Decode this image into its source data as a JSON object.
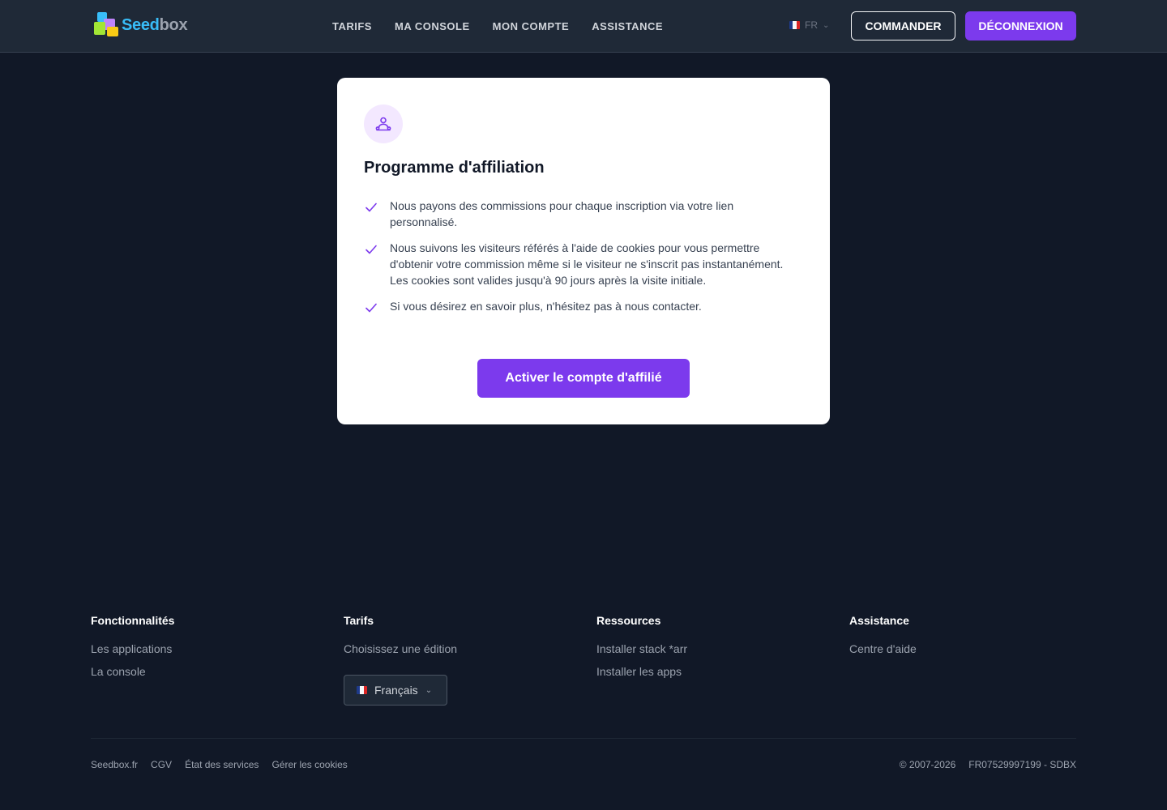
{
  "brand": {
    "part1": "Seed",
    "part2": "box"
  },
  "nav": {
    "items": [
      {
        "label": "TARIFS"
      },
      {
        "label": "MA CONSOLE"
      },
      {
        "label": "MON COMPTE"
      },
      {
        "label": "ASSISTANCE"
      }
    ]
  },
  "language": {
    "current_code": "FR",
    "current_name": "Français"
  },
  "header": {
    "order_label": "COMMANDER",
    "logout_label": "DÉCONNEXION"
  },
  "card": {
    "icon": "users-icon",
    "title": "Programme d'affiliation",
    "features": [
      "Nous payons des commissions pour chaque inscription via votre lien personnalisé.",
      "Nous suivons les visiteurs référés à l'aide de cookies pour vous permettre d'obtenir votre commission même si le visiteur ne s'inscrit pas instantanément. Les cookies sont valides jusqu'à 90 jours après la visite initiale.",
      "Si vous désirez en savoir plus, n'hésitez pas à nous contacter."
    ],
    "cta_label": "Activer le compte d'affilié"
  },
  "footer": {
    "columns": [
      {
        "heading": "Fonctionnalités",
        "links": [
          "Les applications",
          "La console"
        ]
      },
      {
        "heading": "Tarifs",
        "links": [
          "Choisissez une édition"
        ]
      },
      {
        "heading": "Ressources",
        "links": [
          "Installer stack *arr",
          "Installer les apps"
        ]
      },
      {
        "heading": "Assistance",
        "links": [
          "Centre d'aide"
        ]
      }
    ],
    "bottom_links": [
      "Seedbox.fr",
      "CGV",
      "État des services",
      "Gérer les cookies"
    ],
    "copyright": "© 2007-2026",
    "company_id": "FR07529997199 - SDBX"
  },
  "colors": {
    "accent": "#7c3aed",
    "background": "#111827",
    "header_bg": "#1f2937",
    "card_bg": "#ffffff"
  }
}
